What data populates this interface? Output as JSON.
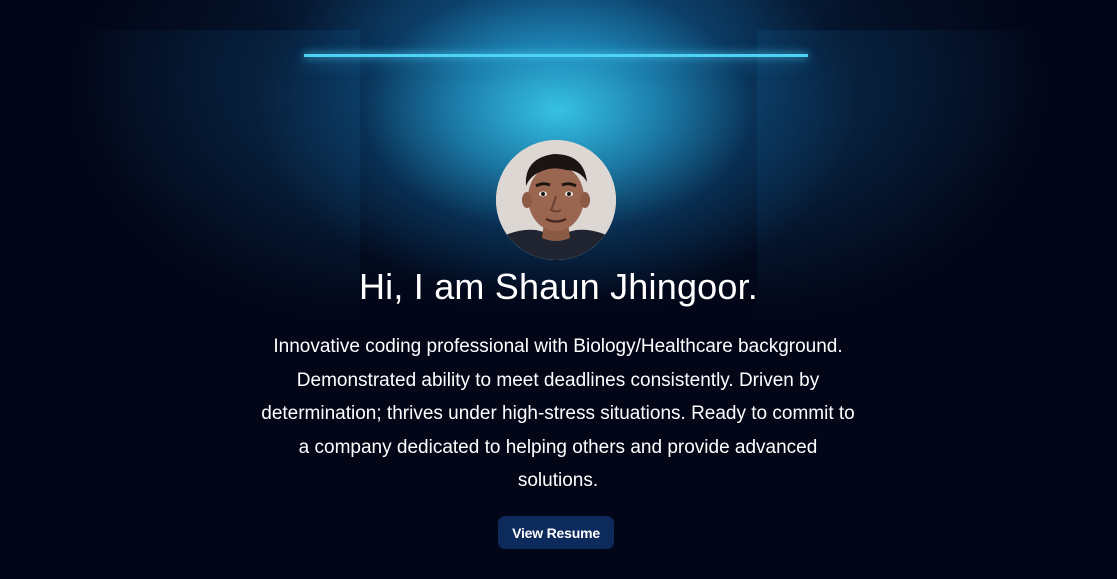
{
  "hero": {
    "headline": "Hi, I am Shaun Jhingoor.",
    "bio": "Innovative coding professional with Biology/Healthcare background. Demonstrated ability to meet deadlines consistently. Driven by determination; thrives under high-stress situations. Ready to commit to a company dedicated to helping others and provide advanced solutions.",
    "resume_button_label": "View Resume"
  },
  "colors": {
    "background": "#020617",
    "lamp": "#4fd3f5",
    "button": "#0d2a5c",
    "text": "#ffffff"
  }
}
